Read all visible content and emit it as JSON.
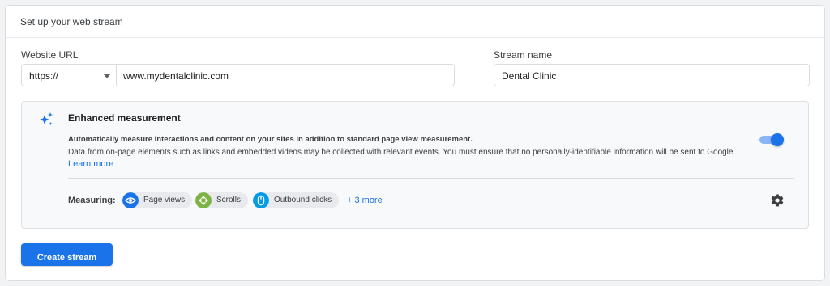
{
  "header": {
    "title": "Set up your web stream"
  },
  "website_url": {
    "label": "Website URL",
    "protocol": "https://",
    "url": "www.mydentalclinic.com"
  },
  "stream_name": {
    "label": "Stream name",
    "value": "Dental Clinic"
  },
  "enhanced_measurement": {
    "title": "Enhanced measurement",
    "summary": "Automatically measure interactions and content on your sites in addition to standard page view measurement.",
    "description": "Data from on-page elements such as links and embedded videos may be collected with relevant events. You must ensure that no personally-identifiable information will be sent to Google. ",
    "learn_more": "Learn more",
    "enabled": true,
    "measuring_label": "Measuring:",
    "chips": [
      {
        "label": "Page views",
        "icon": "eye-icon",
        "color": "#1a73e8"
      },
      {
        "label": "Scrolls",
        "icon": "scroll-icon",
        "color": "#7cb342"
      },
      {
        "label": "Outbound clicks",
        "icon": "mouse-icon",
        "color": "#039be5"
      }
    ],
    "more": "+ 3 more"
  },
  "actions": {
    "create_label": "Create stream"
  },
  "colors": {
    "accent": "#1a73e8",
    "toggle_track": "#8ab4f8"
  }
}
